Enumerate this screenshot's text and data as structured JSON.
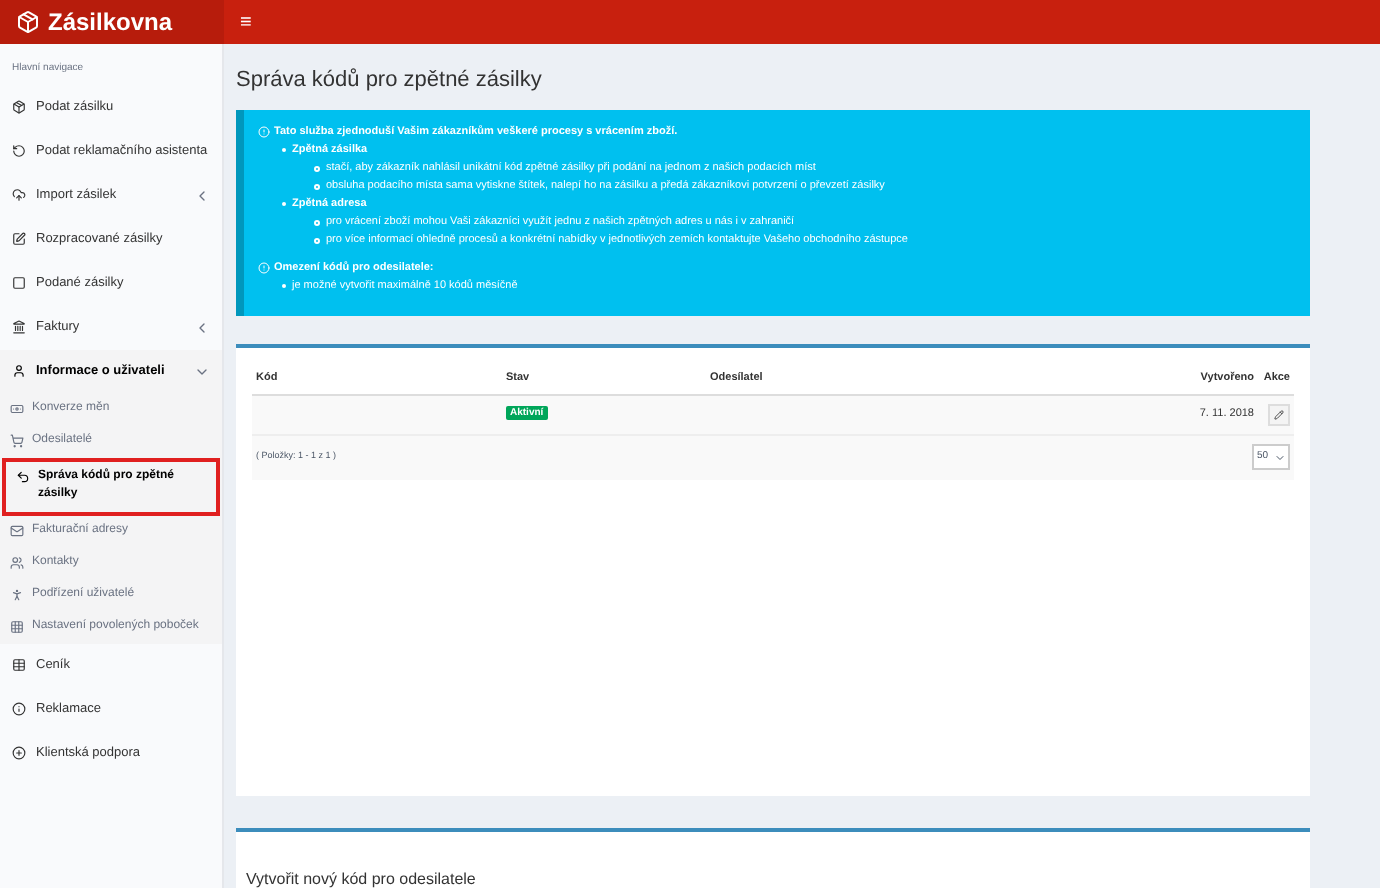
{
  "header": {
    "logo": "Zásilkovna",
    "menu_toggle": "≡"
  },
  "sidebar": {
    "heading": "Hlavní navigace",
    "items": [
      {
        "label": "Podat zásilku"
      },
      {
        "label": "Podat reklamačního asistenta"
      },
      {
        "label": "Import zásilek",
        "expanded": false
      },
      {
        "label": "Rozpracované zásilky"
      },
      {
        "label": "Podané zásilky"
      },
      {
        "label": "Faktury",
        "expanded": false
      },
      {
        "label": "Informace o uživateli",
        "expanded": true,
        "children": [
          {
            "label": "Konverze měn",
            "selected": false
          },
          {
            "label": "Odesilatelé",
            "selected": false
          },
          {
            "label": "Správa kódů pro zpětné zásilky",
            "selected": true
          },
          {
            "label": "Fakturační adresy",
            "selected": false
          },
          {
            "label": "Kontakty",
            "selected": false
          },
          {
            "label": "Podřízení uživatelé",
            "selected": false
          },
          {
            "label": "Nastavení povolených poboček",
            "selected": false
          }
        ]
      },
      {
        "label": "Ceník"
      },
      {
        "label": "Reklamace"
      },
      {
        "label": "Klientská podpora"
      }
    ]
  },
  "page_title": "Správa kódů pro zpětné zásilky",
  "info": {
    "heading": "Tato služba zjednoduší Vašim zákazníkům veškeré procesy s vrácením zboží.",
    "items": [
      {
        "title": "Zpětná zásilka",
        "children": [
          "stačí, aby zákazník nahlásil unikátní kód zpětné zásilky při podání na jednom z našich podacích míst",
          "obsluha podacího místa sama vytiskne štítek, nalepí ho na zásilku a předá zákazníkovi potvrzení o převzetí zásilky"
        ]
      },
      {
        "title": "Zpětná adresa",
        "children": [
          "pro vrácení zboží mohou Vaši zákazníci využít jednu z našich zpětných adres u nás i v zahraničí",
          "pro více informací ohledně procesů a konkrétní nabídky v jednotlivých zemích kontaktujte Vašeho obchodního zástupce"
        ]
      }
    ]
  },
  "limit": {
    "heading": "Omezení kódů pro odesilatele:",
    "items": [
      "je možné vytvořit maximálně 10 kódů měsíčně"
    ]
  },
  "table": {
    "columns": [
      "Kód",
      "Stav",
      "Odesílatel",
      "Vytvořeno",
      "Akce"
    ],
    "rows": [
      {
        "status": "Aktivní",
        "created": "7. 11. 2018"
      }
    ],
    "footer": "( Položky: 1 - 1 z 1 )",
    "page_size": "50"
  },
  "create_panel": {
    "title": "Vytvořit nový kód pro odesilatele"
  }
}
